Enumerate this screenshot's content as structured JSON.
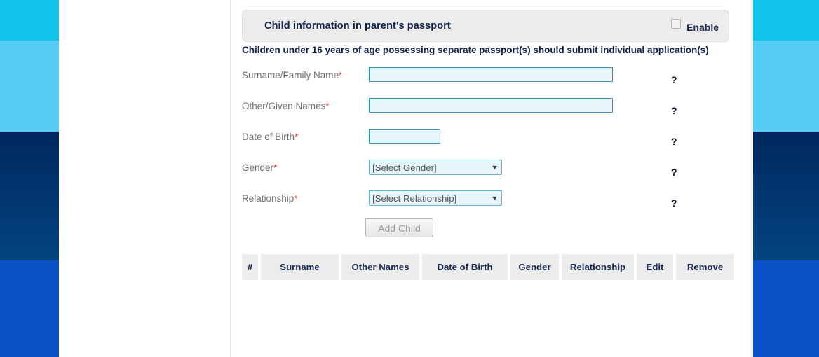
{
  "decor": {
    "colors": {
      "cyan": "#10c3ec",
      "sky": "#55cdf4",
      "navy": "#01285e",
      "blue": "#0a51c6"
    }
  },
  "section": {
    "title": "Child information in parent's passport",
    "enable_label": "Enable",
    "checkbox_checked": false,
    "notice": "Children under 16 years of age possessing separate passport(s) should submit individual application(s)"
  },
  "form": {
    "required_marker": "*",
    "help_marker": "?",
    "fields": [
      {
        "label": "Surname/Family Name",
        "required": true,
        "type": "text",
        "value": "",
        "placeholder": ""
      },
      {
        "label": "Other/Given Names",
        "required": true,
        "type": "text",
        "value": "",
        "placeholder": ""
      },
      {
        "label": "Date of Birth",
        "required": true,
        "type": "text",
        "value": "",
        "placeholder": ""
      },
      {
        "label": "Gender",
        "required": true,
        "type": "select",
        "value": "[Select Gender]"
      },
      {
        "label": "Relationship",
        "required": true,
        "type": "select",
        "value": "[Select Relationship]"
      }
    ],
    "caret_glyph": "▼",
    "add_button_label": "Add Child"
  },
  "table": {
    "columns": [
      "#",
      "Surname",
      "Other Names",
      "Date of Birth",
      "Gender",
      "Relationship",
      "Edit",
      "Remove"
    ],
    "rows": []
  }
}
